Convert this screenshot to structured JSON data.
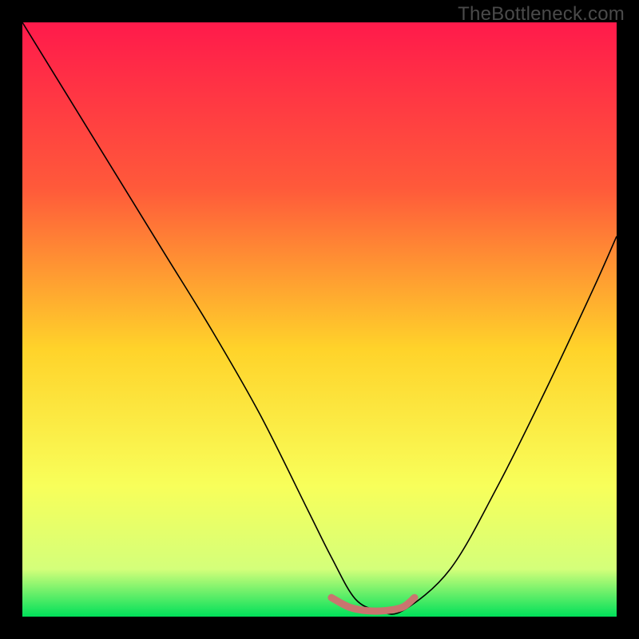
{
  "watermark": "TheBottleneck.com",
  "chart_data": {
    "type": "line",
    "title": "",
    "xlabel": "",
    "ylabel": "",
    "xlim": [
      0,
      100
    ],
    "ylim": [
      0,
      100
    ],
    "background_gradient": {
      "stops": [
        {
          "offset": 0,
          "color": "#ff1a4b"
        },
        {
          "offset": 28,
          "color": "#ff5a3a"
        },
        {
          "offset": 55,
          "color": "#ffd32a"
        },
        {
          "offset": 78,
          "color": "#f8ff5a"
        },
        {
          "offset": 92,
          "color": "#d4ff7a"
        },
        {
          "offset": 100,
          "color": "#00e05a"
        }
      ]
    },
    "series": [
      {
        "name": "bottleneck-curve",
        "color": "#000000",
        "width": 1.6,
        "x": [
          0,
          8,
          16,
          24,
          32,
          40,
          48,
          52,
          56,
          60,
          64,
          72,
          80,
          88,
          96,
          100
        ],
        "y": [
          100,
          87,
          74,
          61,
          48,
          34,
          18,
          10,
          3,
          1,
          1,
          8,
          22,
          38,
          55,
          64
        ]
      },
      {
        "name": "optimal-band",
        "color": "#c9756f",
        "width": 9,
        "linecap": "round",
        "x": [
          52,
          55,
          58,
          61,
          64,
          66
        ],
        "y": [
          3.2,
          1.6,
          1.0,
          1.0,
          1.6,
          3.2
        ]
      }
    ]
  }
}
